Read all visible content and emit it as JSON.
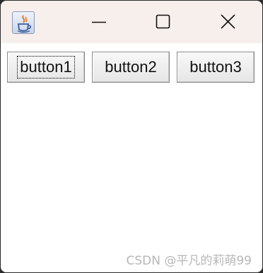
{
  "window": {
    "app_icon": "java-app-icon",
    "controls": {
      "minimize_icon": "minimize-icon",
      "maximize_icon": "maximize-icon",
      "close_icon": "close-icon"
    }
  },
  "buttons": [
    {
      "label": "button1",
      "focused": true
    },
    {
      "label": "button2",
      "focused": false
    },
    {
      "label": "button3",
      "focused": false
    }
  ],
  "watermark": "CSDN @平凡的莉萌99",
  "colors": {
    "titlebar": "#f7efec",
    "content": "#ffffff",
    "button_face": "#eeeeee",
    "watermark": "#b7b7b7"
  }
}
